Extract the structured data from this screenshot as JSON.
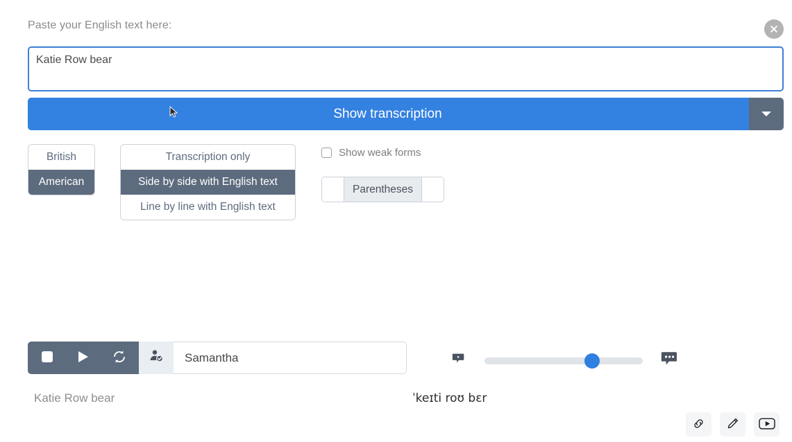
{
  "header": {
    "prompt_label": "Paste your English text here:",
    "close_icon": "close-circle-icon"
  },
  "input": {
    "value": "Katie Row bear",
    "placeholder": "Paste your English text here:"
  },
  "main_action": {
    "label": "Show transcription",
    "caret_icon": "chevron-down-icon",
    "accent_color": "#3381e0",
    "caret_bg_color": "#5d6b7e"
  },
  "accent_group": {
    "name": "accent",
    "options": [
      {
        "label": "British",
        "active": false
      },
      {
        "label": "American",
        "active": true
      }
    ]
  },
  "layout_group": {
    "name": "display-layout",
    "options": [
      {
        "label": "Transcription only",
        "active": false
      },
      {
        "label": "Side by side with English text",
        "active": true
      },
      {
        "label": "Line by line with English text",
        "active": false
      }
    ]
  },
  "weak_forms": {
    "label": "Show weak forms",
    "checked": false
  },
  "parentheses_group": {
    "segments": [
      {
        "label": "",
        "active": false
      },
      {
        "label": "Parentheses",
        "active": true
      },
      {
        "label": "",
        "active": false
      }
    ]
  },
  "player": {
    "stop_icon": "stop-icon",
    "play_icon": "play-icon",
    "loop_icon": "loop-icon",
    "voice_icon": "person-check-icon",
    "voice_name": "Samantha",
    "slow_icon": "speech-bubble-small-icon",
    "fast_icon": "speech-bubble-large-icon",
    "speed_percent": 68
  },
  "result": {
    "english": "Katie Row bear",
    "ipa": "ˈkeɪti roʊ bɛr"
  },
  "tools": [
    {
      "name": "link-icon",
      "label": "Link"
    },
    {
      "name": "pencil-icon",
      "label": "Edit"
    },
    {
      "name": "youtube-play-icon",
      "label": "Video"
    }
  ]
}
